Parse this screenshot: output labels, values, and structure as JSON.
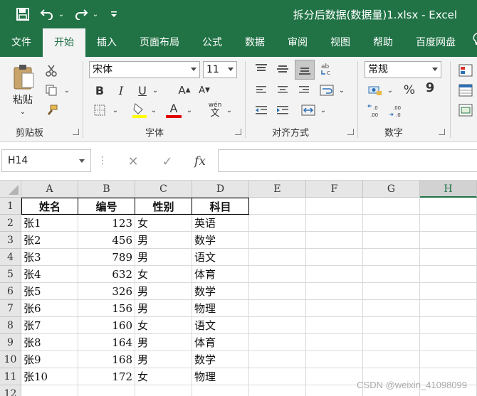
{
  "window": {
    "title": "拆分后数据(数据量)1.xlsx  -  Excel"
  },
  "quick_access": {
    "save_icon": "save-icon",
    "undo_icon": "undo-icon",
    "redo_icon": "redo-icon",
    "customize_icon": "customize-icon"
  },
  "tabs": [
    "文件",
    "开始",
    "插入",
    "页面布局",
    "公式",
    "数据",
    "审阅",
    "视图",
    "帮助",
    "百度网盘"
  ],
  "active_tab": "开始",
  "ribbon": {
    "clipboard": {
      "paste_label": "粘贴",
      "group_label": "剪贴板"
    },
    "font": {
      "font_name": "宋体",
      "font_size": "11",
      "bold": "B",
      "italic": "I",
      "underline": "U",
      "grow": "A",
      "shrink": "A",
      "font_color_label": "A",
      "phonetic_label": "wén",
      "group_label": "字体"
    },
    "alignment": {
      "group_label": "对齐方式"
    },
    "number": {
      "format": "常规",
      "percent": "%",
      "comma": "9",
      "group_label": "数字"
    }
  },
  "formula_bar": {
    "name_box": "H14",
    "fx": "fx",
    "formula": ""
  },
  "sheet": {
    "columns": [
      "A",
      "B",
      "C",
      "D",
      "E",
      "F",
      "G",
      "H"
    ],
    "selected_column": "H",
    "rows": [
      {
        "num": "1",
        "cells": [
          "姓名",
          "编号",
          "性别",
          "科目"
        ]
      },
      {
        "num": "2",
        "cells": [
          "张1",
          "123",
          "女",
          "英语"
        ]
      },
      {
        "num": "3",
        "cells": [
          "张2",
          "456",
          "男",
          "数学"
        ]
      },
      {
        "num": "4",
        "cells": [
          "张3",
          "789",
          "男",
          "语文"
        ]
      },
      {
        "num": "5",
        "cells": [
          "张4",
          "632",
          "女",
          "体育"
        ]
      },
      {
        "num": "6",
        "cells": [
          "张5",
          "326",
          "男",
          "数学"
        ]
      },
      {
        "num": "7",
        "cells": [
          "张6",
          "156",
          "男",
          "物理"
        ]
      },
      {
        "num": "8",
        "cells": [
          "张7",
          "160",
          "女",
          "语文"
        ]
      },
      {
        "num": "9",
        "cells": [
          "张8",
          "164",
          "男",
          "体育"
        ]
      },
      {
        "num": "10",
        "cells": [
          "张9",
          "168",
          "男",
          "数学"
        ]
      },
      {
        "num": "11",
        "cells": [
          "张10",
          "172",
          "女",
          "物理"
        ]
      },
      {
        "num": "12",
        "cells": [
          "",
          "",
          "",
          ""
        ]
      }
    ]
  },
  "watermark": "CSDN @weixin_41098099",
  "colors": {
    "accent": "#217346",
    "font_color_bar": "#e00000",
    "highlight_bar": "#ffff00"
  }
}
